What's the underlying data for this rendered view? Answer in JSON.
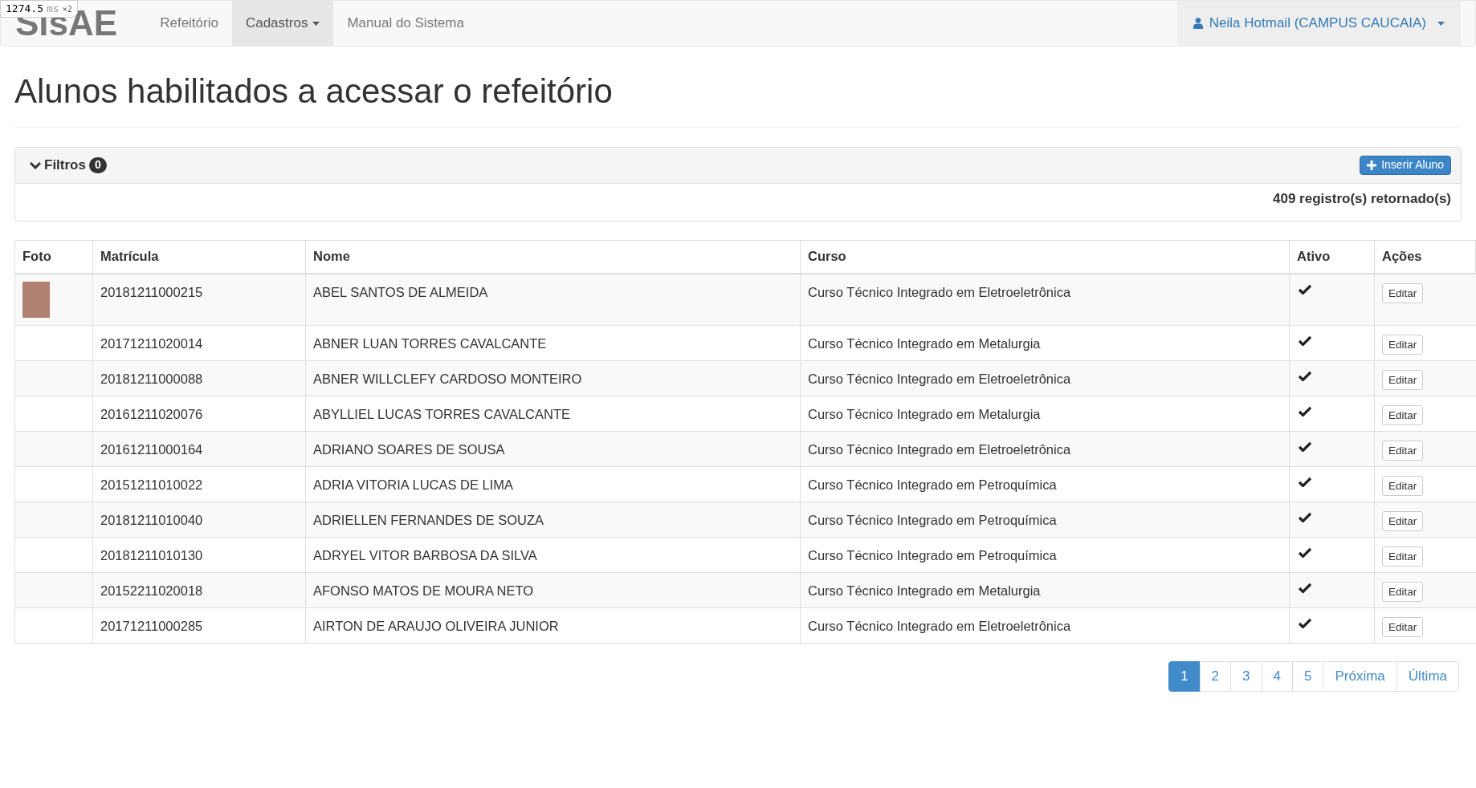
{
  "perf_overlay": {
    "value": "1274.5",
    "unit": "ms",
    "multiplier": "×2"
  },
  "navbar": {
    "brand": "SisAE",
    "items": [
      {
        "label": "Refeitório",
        "selected": false,
        "dropdown": false
      },
      {
        "label": "Cadastros",
        "selected": true,
        "dropdown": true
      },
      {
        "label": "Manual do Sistema",
        "selected": false,
        "dropdown": false
      }
    ],
    "user": "Neila Hotmail (CAMPUS CAUCAIA)"
  },
  "page_title": "Alunos habilitados a acessar o refeitório",
  "filters": {
    "label": "Filtros",
    "count": "0",
    "expanded": true,
    "insert_button": "Inserir Aluno",
    "records": "409 registro(s) retornado(s)"
  },
  "table": {
    "columns": [
      "Foto",
      "Matrícula",
      "Nome",
      "Curso",
      "Ativo",
      "Ações"
    ],
    "rows": [
      {
        "photo": true,
        "matricula": "20181211000215",
        "nome": "ABEL SANTOS DE ALMEIDA",
        "curso": "Curso Técnico Integrado em Eletroeletrônica",
        "active": true,
        "action": "Editar"
      },
      {
        "photo": false,
        "matricula": "20171211020014",
        "nome": "ABNER LUAN TORRES CAVALCANTE",
        "curso": "Curso Técnico Integrado em Metalurgia",
        "active": true,
        "action": "Editar"
      },
      {
        "photo": false,
        "matricula": "20181211000088",
        "nome": "ABNER WILLCLEFY CARDOSO MONTEIRO",
        "curso": "Curso Técnico Integrado em Eletroeletrônica",
        "active": true,
        "action": "Editar"
      },
      {
        "photo": false,
        "matricula": "20161211020076",
        "nome": "ABYLLIEL LUCAS TORRES CAVALCANTE",
        "curso": "Curso Técnico Integrado em Metalurgia",
        "active": true,
        "action": "Editar"
      },
      {
        "photo": false,
        "matricula": "20161211000164",
        "nome": "ADRIANO SOARES DE SOUSA",
        "curso": "Curso Técnico Integrado em Eletroeletrônica",
        "active": true,
        "action": "Editar"
      },
      {
        "photo": false,
        "matricula": "20151211010022",
        "nome": "ADRIA VITORIA LUCAS DE LIMA",
        "curso": "Curso Técnico Integrado em Petroquímica",
        "active": true,
        "action": "Editar"
      },
      {
        "photo": false,
        "matricula": "20181211010040",
        "nome": "ADRIELLEN FERNANDES DE SOUZA",
        "curso": "Curso Técnico Integrado em Petroquímica",
        "active": true,
        "action": "Editar"
      },
      {
        "photo": false,
        "matricula": "20181211010130",
        "nome": "ADRYEL VITOR BARBOSA DA SILVA",
        "curso": "Curso Técnico Integrado em Petroquímica",
        "active": true,
        "action": "Editar"
      },
      {
        "photo": false,
        "matricula": "20152211020018",
        "nome": "AFONSO MATOS DE MOURA NETO",
        "curso": "Curso Técnico Integrado em Metalurgia",
        "active": true,
        "action": "Editar"
      },
      {
        "photo": false,
        "matricula": "20171211000285",
        "nome": "AIRTON DE ARAUJO OLIVEIRA JUNIOR",
        "curso": "Curso Técnico Integrado em Eletroeletrônica",
        "active": true,
        "action": "Editar"
      }
    ]
  },
  "pagination": [
    {
      "label": "1",
      "selected": true
    },
    {
      "label": "2",
      "selected": false
    },
    {
      "label": "3",
      "selected": false
    },
    {
      "label": "4",
      "selected": false
    },
    {
      "label": "5",
      "selected": false
    },
    {
      "label": "Próxima",
      "selected": false
    },
    {
      "label": "Última",
      "selected": false
    }
  ]
}
